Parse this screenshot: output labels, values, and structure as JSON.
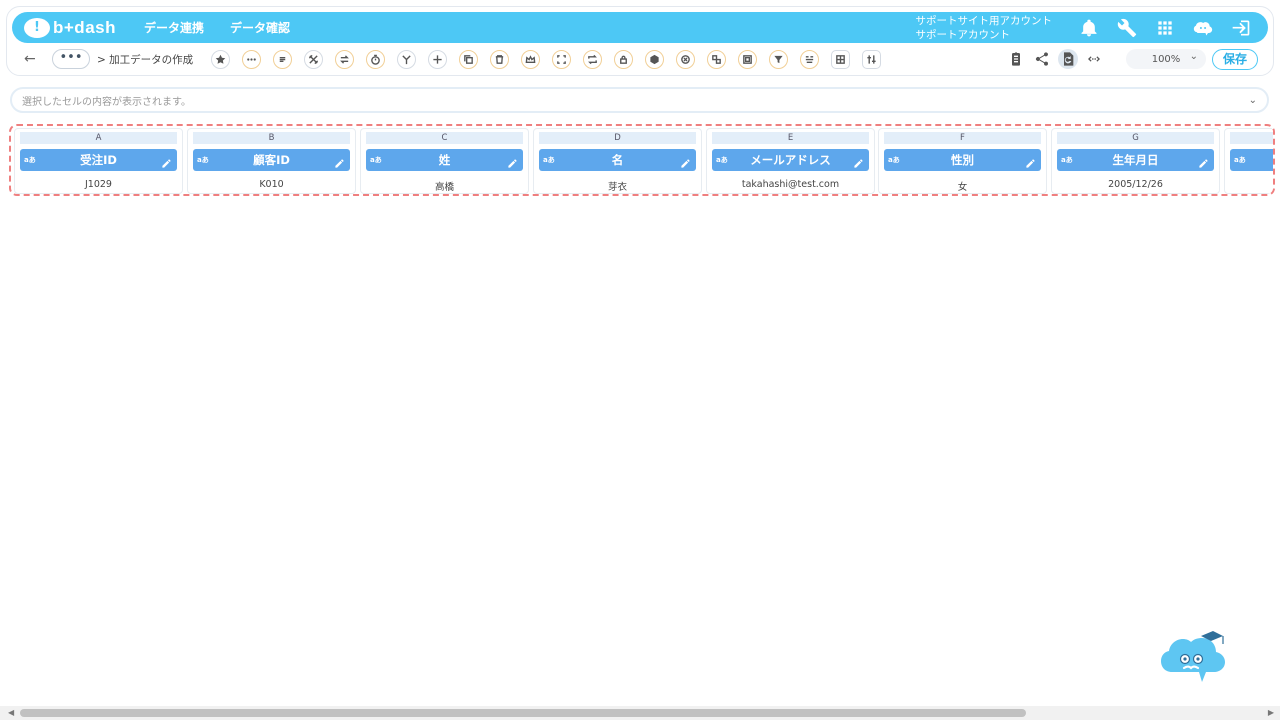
{
  "app": {
    "logo_text": "b+dash",
    "logo_mark": "!"
  },
  "nav": {
    "items": [
      "データ連携",
      "データ確認"
    ]
  },
  "account": {
    "line1": "サポートサイト用アカウント",
    "line2": "サポートアカウント"
  },
  "top_icons": [
    "bell-icon",
    "wrench-icon",
    "apps-grid-icon",
    "mascot-chat-icon",
    "logout-icon"
  ],
  "toolbar": {
    "back_glyph": "←",
    "more_glyph": "•••",
    "breadcrumb": "> 加工データの作成",
    "tools": [
      "star",
      "more",
      "list",
      "split",
      "swap",
      "timer",
      "merge",
      "add",
      "copy",
      "delete",
      "crown",
      "expand",
      "repeat",
      "lock",
      "box",
      "cancel",
      "convert",
      "frame",
      "filter",
      "group",
      "table",
      "columns"
    ],
    "zoom_value": "100%",
    "zoom_chevron": "⌄",
    "save_label": "保存"
  },
  "formula_bar": {
    "placeholder": "選択したセルの内容が表示されます。",
    "chevron": "⌄"
  },
  "columns": [
    {
      "letter": "A",
      "type": "aあ",
      "name": "受注ID",
      "value": "J1029"
    },
    {
      "letter": "B",
      "type": "aあ",
      "name": "顧客ID",
      "value": "K010"
    },
    {
      "letter": "C",
      "type": "aあ",
      "name": "姓",
      "value": "高橋"
    },
    {
      "letter": "D",
      "type": "aあ",
      "name": "名",
      "value": "芽衣"
    },
    {
      "letter": "E",
      "type": "aあ",
      "name": "メールアドレス",
      "value": "takahashi@test.com"
    },
    {
      "letter": "F",
      "type": "aあ",
      "name": "性別",
      "value": "女"
    },
    {
      "letter": "G",
      "type": "aあ",
      "name": "生年月日",
      "value": "2005/12/26"
    },
    {
      "letter": "",
      "type": "aあ",
      "name": "",
      "value": ""
    }
  ],
  "colors": {
    "brand": "#4dc8f5",
    "column_header": "#5ea7ec",
    "highlight_border": "#ef7f7f"
  }
}
